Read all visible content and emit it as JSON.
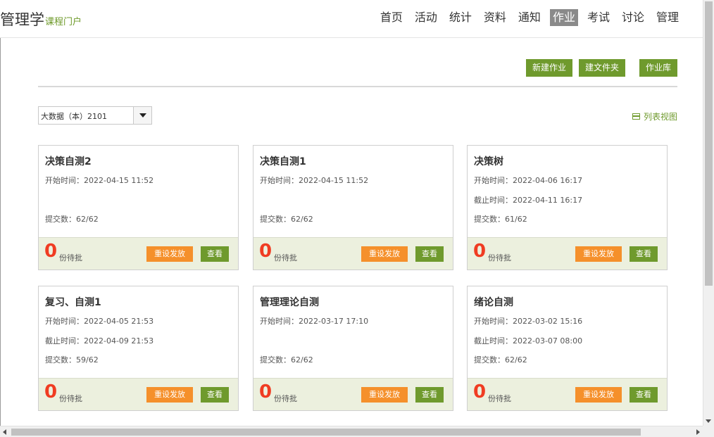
{
  "header": {
    "brand_title": "管理学",
    "brand_sub": "课程门户",
    "nav": [
      {
        "label": "首页",
        "active": false
      },
      {
        "label": "活动",
        "active": false
      },
      {
        "label": "统计",
        "active": false
      },
      {
        "label": "资料",
        "active": false
      },
      {
        "label": "通知",
        "active": false
      },
      {
        "label": "作业",
        "active": true
      },
      {
        "label": "考试",
        "active": false
      },
      {
        "label": "讨论",
        "active": false
      },
      {
        "label": "管理",
        "active": false
      }
    ]
  },
  "toolbar": {
    "new_assignment": "新建作业",
    "new_folder": "建文件夹",
    "assignment_library": "作业库"
  },
  "filter": {
    "class_selected": "大数据（本）2101",
    "list_view": "列表视图"
  },
  "cards": [
    {
      "title": "决策自测2",
      "lines": [
        "开始时间：2022-04-15 11:52",
        "",
        "提交数：62/62"
      ],
      "pending": "0",
      "pending_label": "份待批",
      "reset_label": "重设发放",
      "view_label": "查看"
    },
    {
      "title": "决策自测1",
      "lines": [
        "开始时间：2022-04-15 11:52",
        "",
        "提交数：62/62"
      ],
      "pending": "0",
      "pending_label": "份待批",
      "reset_label": "重设发放",
      "view_label": "查看"
    },
    {
      "title": "决策树",
      "lines": [
        "开始时间：2022-04-06 16:17",
        "截止时间：2022-04-11 16:17",
        "提交数：61/62"
      ],
      "pending": "0",
      "pending_label": "份待批",
      "reset_label": "重设发放",
      "view_label": "查看"
    },
    {
      "title": "复习、自测1",
      "lines": [
        "开始时间：2022-04-05 21:53",
        "截止时间：2022-04-09 21:53",
        "提交数：59/62"
      ],
      "pending": "0",
      "pending_label": "份待批",
      "reset_label": "重设发放",
      "view_label": "查看"
    },
    {
      "title": "管理理论自测",
      "lines": [
        "开始时间：2022-03-17 17:10",
        "",
        "提交数：62/62"
      ],
      "pending": "0",
      "pending_label": "份待批",
      "reset_label": "重设发放",
      "view_label": "查看"
    },
    {
      "title": "绪论自测",
      "lines": [
        "开始时间：2022-03-02 15:16",
        "截止时间：2022-03-07 08:00",
        "提交数：62/62"
      ],
      "pending": "0",
      "pending_label": "份待批",
      "reset_label": "重设发放",
      "view_label": "查看"
    }
  ],
  "colors": {
    "accent_green": "#6f9a2d",
    "reset_orange": "#f5902b",
    "pending_red": "#f03c22",
    "footer_bg": "#ecf0de"
  }
}
